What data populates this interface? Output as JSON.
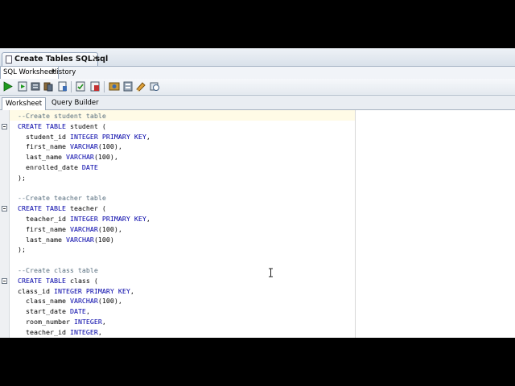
{
  "file_tab": {
    "title": "Create Tables SQL.sql",
    "close": "×"
  },
  "subtabs": {
    "sql_worksheet": "SQL Worksheet",
    "history": "History"
  },
  "toolbar": {
    "icons": [
      "run-statement-icon",
      "run-script-icon",
      "autotrace-icon",
      "explain-plan-icon",
      "sql-tuning-icon",
      "commit-icon",
      "rollback-icon",
      "unshared-sql-icon",
      "format-icon",
      "clear-icon",
      "history-icon"
    ]
  },
  "worksheet_tabs": {
    "worksheet": "Worksheet",
    "query_builder": "Query Builder"
  },
  "code_lines": [
    {
      "comment": "--Create student table"
    },
    {
      "kw1": "CREATE TABLE",
      "rest": " student ("
    },
    {
      "indent": "  ",
      "ident": "student_id",
      "kw1": " INTEGER PRIMARY KEY",
      "rest": ","
    },
    {
      "indent": "  ",
      "ident": "first_name",
      "kw1": " VARCHAR",
      "rest": "(100),"
    },
    {
      "indent": "  ",
      "ident": "last_name",
      "kw1": " VARCHAR",
      "rest": "(100),"
    },
    {
      "indent": "  ",
      "ident": "enrolled_date",
      "kw1": " DATE",
      "rest": ""
    },
    {
      "rest": ");"
    },
    {},
    {
      "comment": "--Create teacher table"
    },
    {
      "kw1": "CREATE TABLE",
      "rest": " teacher ("
    },
    {
      "indent": "  ",
      "ident": "teacher_id",
      "kw1": " INTEGER PRIMARY KEY",
      "rest": ","
    },
    {
      "indent": "  ",
      "ident": "first_name",
      "kw1": " VARCHAR",
      "rest": "(100),"
    },
    {
      "indent": "  ",
      "ident": "last_name",
      "kw1": " VARCHAR",
      "rest": "(100)"
    },
    {
      "rest": ");"
    },
    {},
    {
      "comment": "--Create class table"
    },
    {
      "kw1": "CREATE TABLE",
      "rest": " class ("
    },
    {
      "ident": "class_id",
      "kw1": " INTEGER PRIMARY KEY",
      "rest": ","
    },
    {
      "indent": "  ",
      "ident": "class_name",
      "kw1": " VARCHAR",
      "rest": "(100),"
    },
    {
      "indent": "  ",
      "ident": "start_date",
      "kw1": " DATE",
      "rest": ","
    },
    {
      "indent": "  ",
      "ident": "room_number",
      "kw1": " INTEGER",
      "rest": ","
    },
    {
      "indent": "  ",
      "ident": "teacher_id",
      "kw1": " INTEGER",
      "rest": ","
    }
  ],
  "fold_lines": [
    1,
    9,
    16
  ]
}
